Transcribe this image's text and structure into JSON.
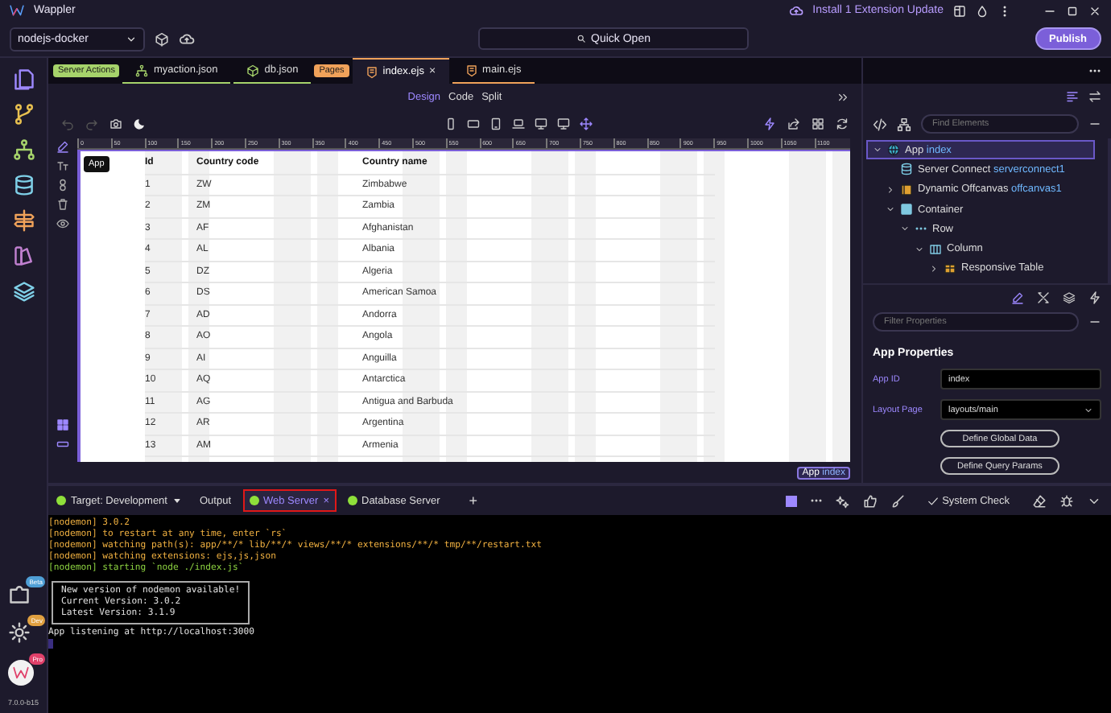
{
  "titlebar": {
    "app_name": "Wappler",
    "update": "Install 1 Extension Update"
  },
  "toolbar": {
    "project": "nodejs-docker",
    "quick_open": "Quick Open",
    "publish": "Publish"
  },
  "activity_badges": [
    {
      "label": "Beta",
      "color": "#4f9fd6"
    },
    {
      "label": "Dev",
      "color": "#e0a040"
    },
    {
      "label": "Pro",
      "color": "#e0406a"
    }
  ],
  "version": "7.0.0-b15",
  "file_tabs": [
    {
      "kind": "group",
      "label": "Server Actions",
      "color": "#a6d36b"
    },
    {
      "kind": "action",
      "label": "myaction.json",
      "selected": false
    },
    {
      "kind": "database",
      "label": "db.json",
      "selected": false
    },
    {
      "kind": "group",
      "label": "Pages",
      "color": "#f0a25a"
    },
    {
      "kind": "page",
      "label": "index.ejs",
      "selected": true,
      "close": "×"
    },
    {
      "kind": "page",
      "label": "main.ejs",
      "selected": false
    }
  ],
  "view_modes": [
    {
      "label": "Design",
      "selected": true
    },
    {
      "label": "Code",
      "selected": false
    },
    {
      "label": "Split",
      "selected": false
    }
  ],
  "ruler": [
    "0",
    "50",
    "100",
    "150",
    "200",
    "250",
    "300",
    "350",
    "400",
    "450",
    "500",
    "550",
    "600",
    "650",
    "700",
    "750",
    "800",
    "850",
    "900",
    "950",
    "1000",
    "1050",
    "1100"
  ],
  "canvas": {
    "tag": "App",
    "columns": [
      "Id",
      "Country code",
      "Country name"
    ],
    "rows": [
      [
        "1",
        "ZW",
        "Zimbabwe"
      ],
      [
        "2",
        "ZM",
        "Zambia"
      ],
      [
        "3",
        "AF",
        "Afghanistan"
      ],
      [
        "4",
        "AL",
        "Albania"
      ],
      [
        "5",
        "DZ",
        "Algeria"
      ],
      [
        "6",
        "DS",
        "American Samoa"
      ],
      [
        "7",
        "AD",
        "Andorra"
      ],
      [
        "8",
        "AO",
        "Angola"
      ],
      [
        "9",
        "AI",
        "Anguilla"
      ],
      [
        "10",
        "AQ",
        "Antarctica"
      ],
      [
        "11",
        "AG",
        "Antigua and Barbuda"
      ],
      [
        "12",
        "AR",
        "Argentina"
      ],
      [
        "13",
        "AM",
        "Armenia"
      ]
    ]
  },
  "breadcrumb": {
    "label": "App",
    "name": "index"
  },
  "elements": {
    "find_placeholder": "Find Elements",
    "tree": [
      {
        "kind": "app",
        "label": "App",
        "name": "index",
        "expanded": true,
        "selected": true,
        "children": [
          {
            "kind": "server",
            "label": "Server Connect",
            "name": "serverconnect1",
            "selected": false
          },
          {
            "kind": "offcanvas",
            "label": "Dynamic Offcanvas",
            "name": "offcanvas1",
            "expanded": false,
            "selected": false
          },
          {
            "kind": "container",
            "label": "Container",
            "expanded": true,
            "selected": false,
            "children": [
              {
                "kind": "row",
                "label": "Row",
                "expanded": true,
                "selected": false,
                "children": [
                  {
                    "kind": "column",
                    "label": "Column",
                    "expanded": true,
                    "selected": false,
                    "children": [
                      {
                        "kind": "table",
                        "label": "Responsive Table",
                        "expanded": false,
                        "selected": false
                      }
                    ]
                  }
                ]
              }
            ]
          }
        ]
      }
    ]
  },
  "properties": {
    "filter_placeholder": "Filter Properties",
    "title": "App Properties",
    "fields": [
      {
        "kind": "text",
        "label": "App ID",
        "value": "index"
      },
      {
        "kind": "select",
        "label": "Layout Page",
        "value": "layouts/main"
      }
    ],
    "buttons": [
      "Define Global Data",
      "Define Query Params"
    ]
  },
  "console_tabs": [
    {
      "kind": "target",
      "label": "Target: Development",
      "running": true,
      "selected": false,
      "highlighted": false
    },
    {
      "kind": "output",
      "label": "Output",
      "selected": false,
      "highlighted": false
    },
    {
      "kind": "server",
      "label": "Web Server",
      "running": true,
      "selected": true,
      "highlighted": true,
      "close": "×"
    },
    {
      "kind": "server",
      "label": "Database Server",
      "running": true,
      "selected": false,
      "highlighted": false
    }
  ],
  "add_tab": "+",
  "system_check": "System Check",
  "console": [
    {
      "kind": "nodemon",
      "text": "[nodemon] 3.0.2"
    },
    {
      "kind": "nodemon",
      "text": "[nodemon] to restart at any time, enter `rs`"
    },
    {
      "kind": "nodemon",
      "text": "[nodemon] watching path(s): app/**/* lib/**/* views/**/* extensions/**/* tmp/**/restart.txt"
    },
    {
      "kind": "nodemon",
      "text": "[nodemon] watching extensions: ejs,js,json"
    },
    {
      "kind": "start",
      "text": "[nodemon] starting `node ./index.js`"
    },
    {
      "kind": "notice",
      "lines": [
        "New version of nodemon available!",
        "Current Version: 3.0.2",
        "Latest Version: 3.1.9"
      ]
    },
    {
      "kind": "plain",
      "text": "App listening at http://localhost:3000"
    }
  ]
}
